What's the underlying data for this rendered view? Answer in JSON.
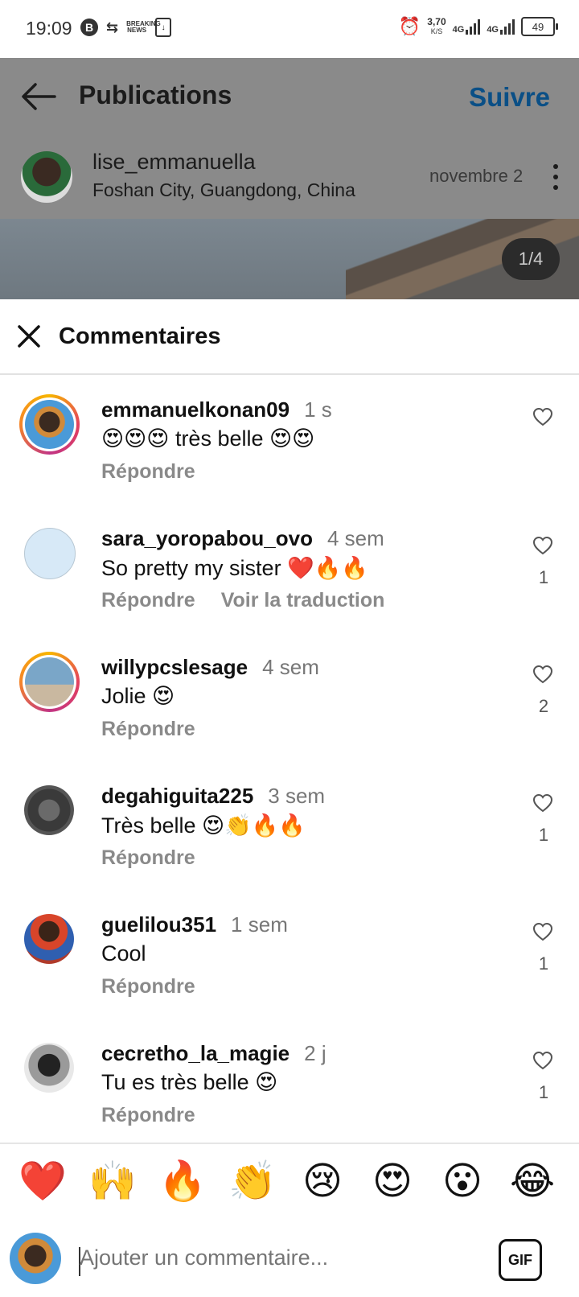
{
  "status_bar": {
    "time": "19:09",
    "network_speed_value": "3,70",
    "network_speed_unit": "K/S",
    "net1": "4G",
    "net2": "4G",
    "battery": "49",
    "news_label": "BREAKING NEWS"
  },
  "header": {
    "title": "Publications",
    "follow_label": "Suivre"
  },
  "post": {
    "username": "lise_emmanuella",
    "location": "Foshan City, Guangdong, China",
    "date": "novembre 2",
    "image_counter": "1/4"
  },
  "comments_sheet": {
    "title": "Commentaires"
  },
  "comments": [
    {
      "user": "emmanuelkonan09",
      "time": "1 s",
      "text": "😍😍😍 très belle 😍😍",
      "reply": "Répondre",
      "likes": ""
    },
    {
      "user": "sara_yoropabou_ovo",
      "time": "4 sem",
      "text": "So pretty my sister ❤️🔥🔥",
      "reply": "Répondre",
      "translate": "Voir la traduction",
      "likes": "1"
    },
    {
      "user": "willypcslesage",
      "time": "4 sem",
      "text": "Jolie 😍",
      "reply": "Répondre",
      "likes": "2"
    },
    {
      "user": "degahiguita225",
      "time": "3 sem",
      "text": "Très belle 😍👏🔥🔥",
      "reply": "Répondre",
      "likes": "1"
    },
    {
      "user": "guelilou351",
      "time": "1 sem",
      "text": "Cool",
      "reply": "Répondre",
      "likes": "1"
    },
    {
      "user": "cecretho_la_magie",
      "time": "2 j",
      "text": "Tu es très belle 😍",
      "reply": "Répondre",
      "likes": "1"
    }
  ],
  "emoji_bar": [
    "❤️",
    "🙌",
    "🔥",
    "👏",
    "😢",
    "😍",
    "😮",
    "😂"
  ],
  "input": {
    "placeholder": "Ajouter un commentaire...",
    "gif_label": "GIF"
  },
  "colors": {
    "follow": "#0a4f86",
    "overlay": "#8a8a8a",
    "muted_text": "#8a8a8a"
  }
}
